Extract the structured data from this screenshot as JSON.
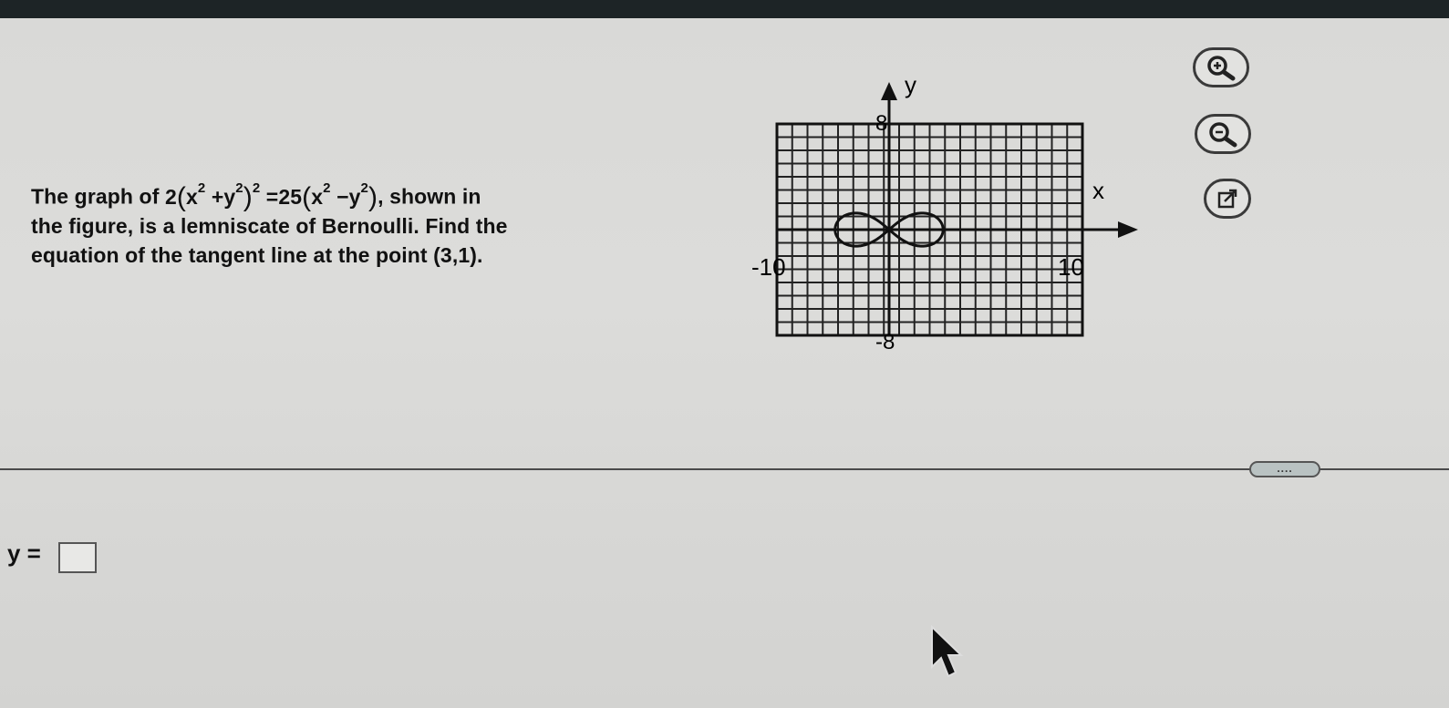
{
  "problem": {
    "lead": "The graph of",
    "eq_left_coef": "2",
    "eq_x": "x",
    "eq_y": "y",
    "eq_exp": "2",
    "eq_plus": "+",
    "eq_minus": "−",
    "eq_equals": "=",
    "eq_right_coef": "25",
    "after_eq": ", shown in",
    "line2": "the figure, is a lemniscate of Bernoulli. Find the",
    "line3": "equation of the tangent line at the point (3,1)."
  },
  "graph": {
    "x_axis_label": "x",
    "y_axis_label": "y",
    "x_min_label": "-10",
    "x_max_label": "10",
    "y_max_label": "8",
    "y_min_label": "-8",
    "x_range": [
      -10,
      10
    ],
    "y_range": [
      -8,
      8
    ]
  },
  "tools": {
    "zoom_in": "zoom-in-icon",
    "zoom_out": "zoom-out-icon",
    "popout": "external-link-icon"
  },
  "handle_label": "....",
  "answer": {
    "label": "y =",
    "value": ""
  }
}
